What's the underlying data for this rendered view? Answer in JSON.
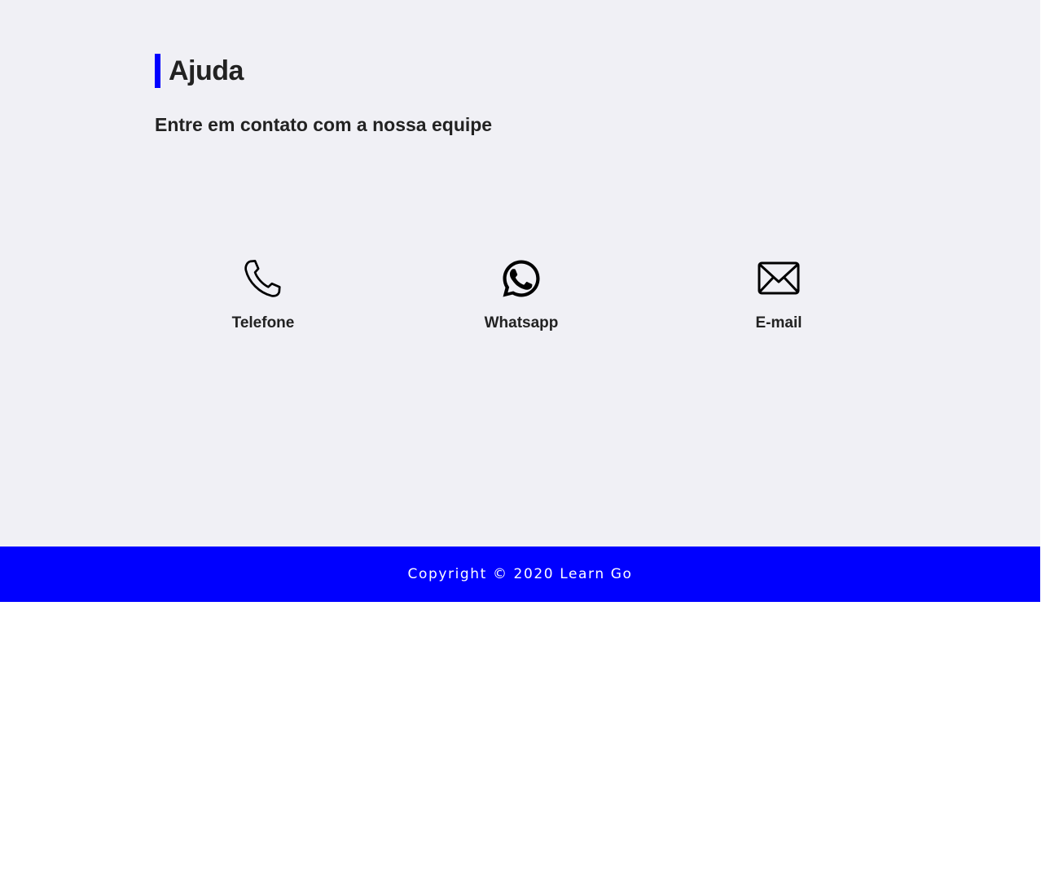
{
  "header": {
    "title": "Ajuda",
    "subtitle": "Entre em contato com a nossa equipe"
  },
  "contacts": [
    {
      "label": "Telefone",
      "icon": "phone-icon"
    },
    {
      "label": "Whatsapp",
      "icon": "whatsapp-icon"
    },
    {
      "label": "E-mail",
      "icon": "mail-icon"
    }
  ],
  "footer": {
    "copyright": "Copyright © 2020 Learn Go"
  },
  "colors": {
    "accent": "#0000ff",
    "background": "#f0f0f5",
    "text": "#222222",
    "footer_text": "#ffffff"
  }
}
